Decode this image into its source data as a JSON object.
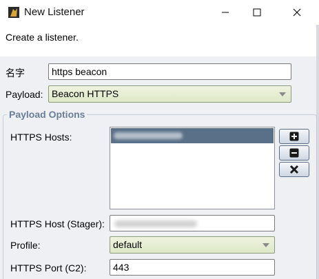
{
  "window": {
    "title": "New Listener"
  },
  "description": "Create a listener.",
  "form": {
    "name_label": "名字",
    "name_value": "https beacon",
    "payload_label": "Payload:",
    "payload_value": "Beacon HTTPS"
  },
  "payload_options": {
    "title": "Payload Options",
    "https_hosts_label": "HTTPS Hosts:",
    "host_stager_label": "HTTPS Host (Stager):",
    "profile_label": "Profile:",
    "profile_value": "default",
    "https_port_label": "HTTPS Port (C2):",
    "https_port_value": "443"
  },
  "colors": {
    "selection": "#5a7089",
    "group_title": "#6b7d98",
    "combo_bg": "#e4ecd2"
  },
  "icons": [
    "app-icon",
    "minimize-icon",
    "maximize-icon",
    "close-icon",
    "add-icon",
    "remove-icon",
    "clear-icon",
    "chevron-down-icon"
  ]
}
